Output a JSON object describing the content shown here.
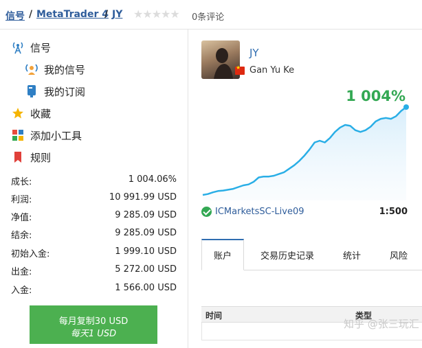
{
  "breadcrumb": {
    "items": [
      "信号",
      "MetaTrader 4",
      "JY"
    ],
    "separator": "/"
  },
  "rating": {
    "stars": 0,
    "max": 5,
    "reviews_label": "0条评论"
  },
  "nav": [
    {
      "label": "信号",
      "icon": "signal-antenna-icon"
    },
    {
      "label": "我的信号",
      "icon": "my-signal-icon"
    },
    {
      "label": "我的订阅",
      "icon": "subscription-icon"
    },
    {
      "label": "收藏",
      "icon": "star-icon"
    },
    {
      "label": "添加小工具",
      "icon": "widget-icon"
    },
    {
      "label": "规则",
      "icon": "bookmark-icon"
    }
  ],
  "stats": [
    {
      "label": "成长:",
      "value": "1 004.06%"
    },
    {
      "label": "利润:",
      "value": "10 991.99 USD"
    },
    {
      "label": "净值:",
      "value": "9 285.09 USD"
    },
    {
      "label": "结余:",
      "value": "9 285.09 USD"
    },
    {
      "label": "初始入金:",
      "value": "1 999.10 USD"
    },
    {
      "label": "出金:",
      "value": "5 272.00 USD"
    },
    {
      "label": "入金:",
      "value": "1 566.00 USD"
    }
  ],
  "subscribe": {
    "monthly": "每月复制30 USD",
    "daily": "每天1 USD"
  },
  "signal": {
    "name": "JY",
    "author": "Gan Yu Ke",
    "growth": "1 004%",
    "broker": "ICMarketsSC-Live09",
    "leverage": "1:500"
  },
  "colors": {
    "accent": "#2f6db0",
    "positive": "#33a853",
    "line": "#29aee6",
    "button": "#4cb050"
  },
  "chart_data": {
    "type": "area",
    "x": [
      0,
      1,
      2,
      3,
      4,
      5,
      6,
      7,
      8,
      9,
      10,
      11,
      12,
      13,
      14,
      15,
      16,
      17,
      18,
      19,
      20,
      21,
      22,
      23,
      24,
      25,
      26,
      27,
      28,
      29,
      30,
      31,
      32,
      33,
      34,
      35,
      36,
      37,
      38,
      39,
      40
    ],
    "values": [
      0,
      10,
      30,
      45,
      50,
      60,
      70,
      90,
      110,
      120,
      150,
      200,
      210,
      210,
      220,
      240,
      260,
      300,
      340,
      390,
      450,
      520,
      600,
      620,
      600,
      650,
      720,
      770,
      800,
      790,
      740,
      720,
      740,
      780,
      840,
      870,
      880,
      870,
      900,
      960,
      1004
    ],
    "ylim": [
      0,
      1004
    ],
    "grid": false
  },
  "tabs": [
    {
      "label": "账户",
      "active": true
    },
    {
      "label": "交易历史记录",
      "active": false
    },
    {
      "label": "统计",
      "active": false
    },
    {
      "label": "风险",
      "active": false
    }
  ],
  "table": {
    "columns": [
      "时间",
      "类型"
    ]
  },
  "watermark": "知乎 @张三玩汇"
}
